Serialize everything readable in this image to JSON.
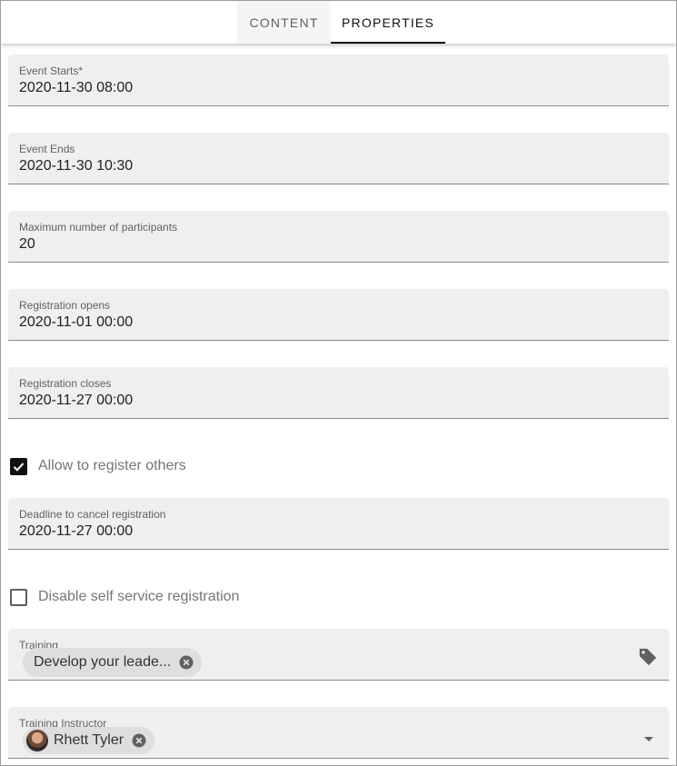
{
  "tabs": [
    {
      "label": "CONTENT",
      "active": false
    },
    {
      "label": "PROPERTIES",
      "active": true
    }
  ],
  "fields": {
    "event_starts": {
      "label": "Event Starts*",
      "value": "2020-11-30 08:00"
    },
    "event_ends": {
      "label": "Event Ends",
      "value": "2020-11-30 10:30"
    },
    "max_participants": {
      "label": "Maximum number of participants",
      "value": "20"
    },
    "registration_opens": {
      "label": "Registration opens",
      "value": "2020-11-01 00:00"
    },
    "registration_closes": {
      "label": "Registration closes",
      "value": "2020-11-27 00:00"
    },
    "cancel_deadline": {
      "label": "Deadline to cancel registration",
      "value": "2020-11-27 00:00"
    },
    "training": {
      "label": "Training",
      "chip": "Develop your leade...",
      "icon": "tag-icon"
    },
    "instructor": {
      "label": "Training Instructor",
      "chip": "Rhett Tyler",
      "icon": "dropdown-arrow-icon"
    }
  },
  "checkboxes": {
    "allow_register_others": {
      "label": "Allow to register others",
      "checked": true
    },
    "disable_self_service": {
      "label": "Disable self service registration",
      "checked": false
    }
  },
  "colors": {
    "field_bg": "#efefef",
    "chip_bg": "#dedede",
    "active_tab": "#111111"
  }
}
